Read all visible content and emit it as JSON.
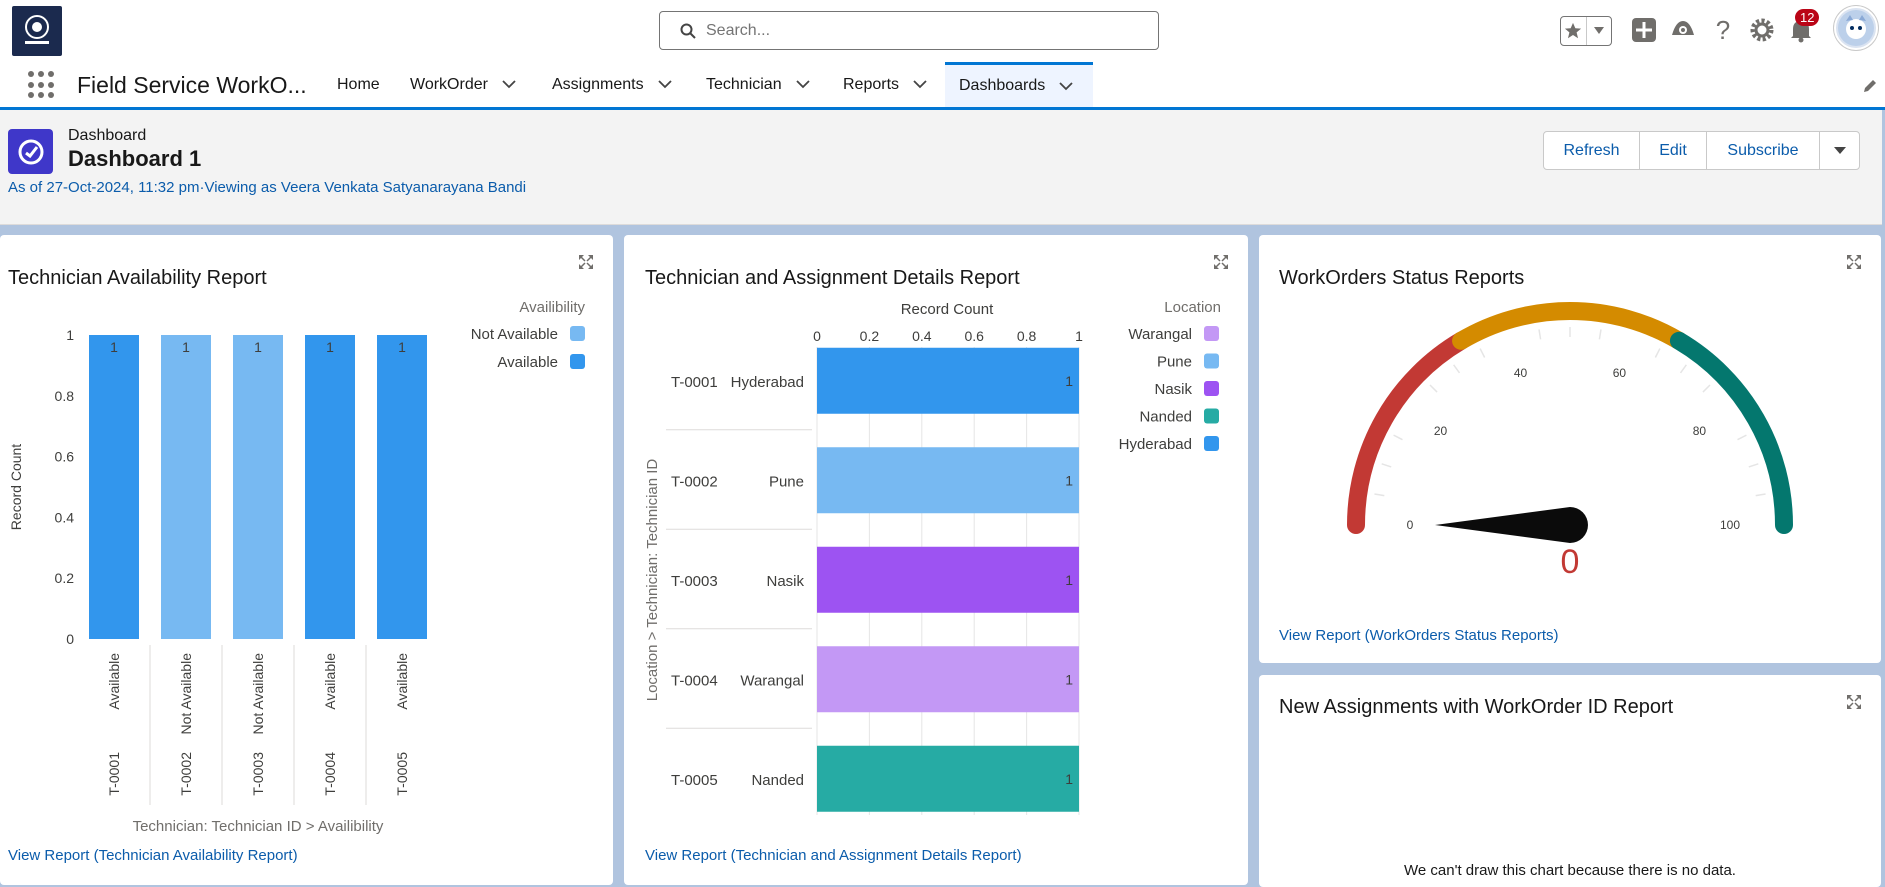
{
  "header": {
    "search_placeholder": "Search...",
    "notification_count": "12",
    "icons": [
      "favorites-star-icon",
      "global-actions-icon",
      "trailhead-icon",
      "help-icon",
      "setup-gear-icon",
      "notifications-bell-icon",
      "user-avatar"
    ]
  },
  "nav": {
    "app_name": "Field Service WorkO...",
    "items": [
      {
        "label": "Home",
        "has_menu": false
      },
      {
        "label": "WorkOrder",
        "has_menu": true
      },
      {
        "label": "Assignments",
        "has_menu": true
      },
      {
        "label": "Technician",
        "has_menu": true
      },
      {
        "label": "Reports",
        "has_menu": true
      },
      {
        "label": "Dashboards",
        "has_menu": true,
        "active": true
      }
    ]
  },
  "page": {
    "type": "Dashboard",
    "title": "Dashboard 1",
    "subtitle": "As of 27-Oct-2024, 11:32 pm·Viewing as Veera Venkata Satyanarayana Bandi",
    "buttons": [
      "Refresh",
      "Edit",
      "Subscribe"
    ]
  },
  "colors": {
    "brand_blue": "#0176d3",
    "link_blue": "#0b5cab",
    "bar_blue": "#3296ed",
    "bar_light_blue": "#77b9f2",
    "bar_purple": "#9d53f2",
    "bar_lavender": "#c398f5",
    "bar_teal": "#26aba4",
    "gauge_red": "#c23934",
    "gauge_amber": "#d48b00",
    "gauge_teal": "#04776e"
  },
  "cards": {
    "availability": {
      "title": "Technician Availability Report",
      "link": "View Report (Technician Availability Report)"
    },
    "assignment": {
      "title": "Technician and Assignment Details Report",
      "link": "View Report (Technician and Assignment Details Report)"
    },
    "status": {
      "title": "WorkOrders Status Reports",
      "link": "View Report (WorkOrders Status Reports)"
    },
    "new_assign": {
      "title": "New Assignments with WorkOrder ID Report",
      "empty_message": "We can't draw this chart because there is no data."
    }
  },
  "chart_data": [
    {
      "type": "bar",
      "orientation": "vertical",
      "ylabel": "Record Count",
      "xlabel": "Technician: Technician ID  >  Availibility",
      "legend_title": "Availibility",
      "legend_position": "top-right",
      "legend": [
        {
          "name": "Not Available",
          "color": "#77b9f2"
        },
        {
          "name": "Available",
          "color": "#3296ed"
        }
      ],
      "ylim": [
        0,
        1
      ],
      "yticks": [
        "0",
        "0.2",
        "0.4",
        "0.6",
        "0.8",
        "1"
      ],
      "categories": [
        {
          "group": "T-0001",
          "sub": "Available",
          "value": 1,
          "color": "#3296ed"
        },
        {
          "group": "T-0002",
          "sub": "Not Available",
          "value": 1,
          "color": "#77b9f2"
        },
        {
          "group": "T-0003",
          "sub": "Not Available",
          "value": 1,
          "color": "#77b9f2"
        },
        {
          "group": "T-0004",
          "sub": "Available",
          "value": 1,
          "color": "#3296ed"
        },
        {
          "group": "T-0005",
          "sub": "Available",
          "value": 1,
          "color": "#3296ed"
        }
      ]
    },
    {
      "type": "bar",
      "orientation": "horizontal",
      "xlabel": "Record Count",
      "ylabel": "Location  >  Technician: Technician ID",
      "legend_title": "Location",
      "legend_position": "top-right",
      "legend": [
        {
          "name": "Warangal",
          "color": "#c398f5"
        },
        {
          "name": "Pune",
          "color": "#77b9f2"
        },
        {
          "name": "Nasik",
          "color": "#9d53f2"
        },
        {
          "name": "Nanded",
          "color": "#26aba4"
        },
        {
          "name": "Hyderabad",
          "color": "#3296ed"
        }
      ],
      "xlim": [
        0,
        1
      ],
      "xticks": [
        "0",
        "0.2",
        "0.4",
        "0.6",
        "0.8",
        "1"
      ],
      "categories": [
        {
          "id": "T-0001",
          "location": "Hyderabad",
          "value": 1,
          "color": "#3296ed"
        },
        {
          "id": "T-0002",
          "location": "Pune",
          "value": 1,
          "color": "#77b9f2"
        },
        {
          "id": "T-0003",
          "location": "Nasik",
          "value": 1,
          "color": "#9d53f2"
        },
        {
          "id": "T-0004",
          "location": "Warangal",
          "value": 1,
          "color": "#c398f5"
        },
        {
          "id": "T-0005",
          "location": "Nanded",
          "value": 1,
          "color": "#26aba4"
        }
      ]
    },
    {
      "type": "gauge",
      "min": 0,
      "max": 100,
      "value": 0,
      "value_label": "0",
      "ticks": [
        "0",
        "20",
        "40",
        "60",
        "80",
        "100"
      ],
      "segments": [
        {
          "from": 0,
          "to": 33,
          "color": "#c23934"
        },
        {
          "from": 33,
          "to": 67,
          "color": "#d48b00"
        },
        {
          "from": 67,
          "to": 100,
          "color": "#04776e"
        }
      ]
    }
  ]
}
